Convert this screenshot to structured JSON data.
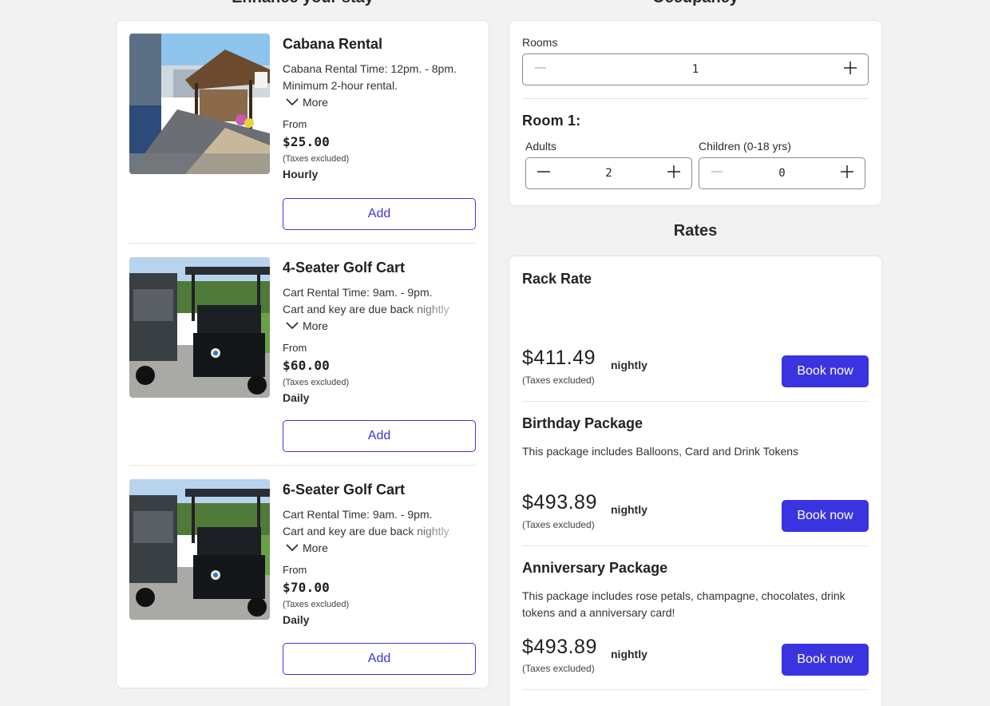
{
  "headings": {
    "left": "Enhance your stay",
    "right_top": "Occupancy",
    "rates": "Rates"
  },
  "addons": [
    {
      "name": "Cabana Rental",
      "desc_lines": [
        "Cabana Rental Time: 12pm. - 8pm.",
        "Minimum 2-hour rental."
      ],
      "more": "More",
      "from": "From",
      "price": "$25.00",
      "tax": "(Taxes excluded)",
      "unit": "Hourly",
      "add": "Add"
    },
    {
      "name": "4-Seater Golf Cart",
      "desc_lines": [
        "Cart Rental Time: 9am. - 9pm.",
        "Cart and key are due back nightly"
      ],
      "more": "More",
      "from": "From",
      "price": "$60.00",
      "tax": "(Taxes excluded)",
      "unit": "Daily",
      "add": "Add"
    },
    {
      "name": "6-Seater Golf Cart",
      "desc_lines": [
        "Cart Rental Time: 9am. - 9pm.",
        "Cart and key are due back nightly"
      ],
      "more": "More",
      "from": "From",
      "price": "$70.00",
      "tax": "(Taxes excluded)",
      "unit": "Daily",
      "add": "Add"
    }
  ],
  "occupancy": {
    "rooms_label": "Rooms",
    "rooms_value": "1",
    "room_title": "Room 1:",
    "adults_label": "Adults",
    "adults_value": "2",
    "children_label": "Children (0-18 yrs)",
    "children_value": "0"
  },
  "rates": [
    {
      "name": "Rack Rate",
      "desc": "",
      "price": "$411.49",
      "per": "nightly",
      "tax": "(Taxes excluded)",
      "book": "Book now"
    },
    {
      "name": "Birthday Package",
      "desc": "This package includes Balloons, Card and Drink Tokens",
      "price": "$493.89",
      "per": "nightly",
      "tax": "(Taxes excluded)",
      "book": "Book now"
    },
    {
      "name": "Anniversary Package",
      "desc": "This package includes rose petals, champagne, chocolates, drink tokens and a anniversary card!",
      "price": "$493.89",
      "per": "nightly",
      "tax": "(Taxes excluded)",
      "book": "Book now"
    }
  ],
  "colors": {
    "accent": "#3a34e0",
    "background": "#f2f2f2",
    "card": "#ffffff"
  },
  "icons": [
    "chevron-down-icon",
    "minus-icon",
    "plus-icon"
  ]
}
